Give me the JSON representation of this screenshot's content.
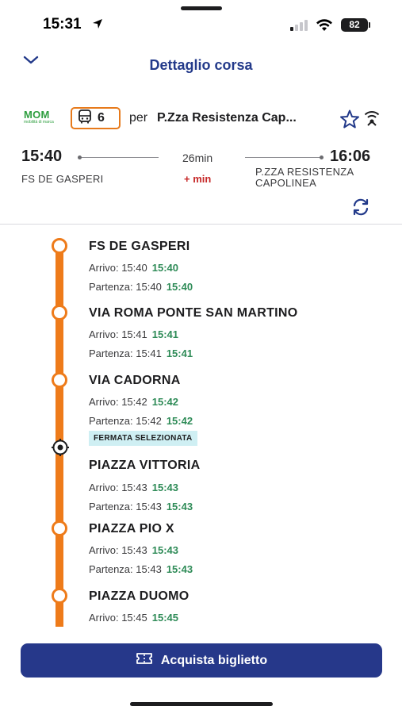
{
  "status_bar": {
    "time": "15:31",
    "battery": "82"
  },
  "header": {
    "title": "Dettaglio corsa"
  },
  "line": {
    "operator_logo": "MOM",
    "operator_tagline": "mobilità di marca",
    "number": "6",
    "per_label": "per",
    "destination": "P.Zza Resistenza Cap..."
  },
  "trip": {
    "departure_time": "15:40",
    "arrival_time": "16:06",
    "duration": "26min",
    "delay": "+ min",
    "from": "FS DE GASPERI",
    "to": "P.ZZA RESISTENZA CAPOLINEA"
  },
  "labels": {
    "arrival": "Arrivo:",
    "departure": "Partenza:",
    "selected_stop": "FERMATA SELEZIONATA"
  },
  "stops": [
    {
      "name": "FS DE GASPERI",
      "arrival": "15:40",
      "arrival_rt": "15:40",
      "departure": "15:40",
      "departure_rt": "15:40",
      "selected": false
    },
    {
      "name": "VIA ROMA PONTE SAN MARTINO",
      "arrival": "15:41",
      "arrival_rt": "15:41",
      "departure": "15:41",
      "departure_rt": "15:41",
      "selected": false
    },
    {
      "name": "VIA CADORNA",
      "arrival": "15:42",
      "arrival_rt": "15:42",
      "departure": "15:42",
      "departure_rt": "15:42",
      "selected": false
    },
    {
      "name": "PIAZZA VITTORIA",
      "arrival": "15:43",
      "arrival_rt": "15:43",
      "departure": "15:43",
      "departure_rt": "15:43",
      "selected": true
    },
    {
      "name": "PIAZZA PIO X",
      "arrival": "15:43",
      "arrival_rt": "15:43",
      "departure": "15:43",
      "departure_rt": "15:43",
      "selected": false
    },
    {
      "name": "PIAZZA DUOMO",
      "arrival": "15:45",
      "arrival_rt": "15:45",
      "departure": "",
      "departure_rt": "",
      "selected": false
    }
  ],
  "buy_button": {
    "label": "Acquista biglietto"
  },
  "colors": {
    "brand_blue": "#26388a",
    "line_orange": "#ee7b1a",
    "realtime_green": "#2e8b57",
    "delay_red": "#c62828"
  }
}
